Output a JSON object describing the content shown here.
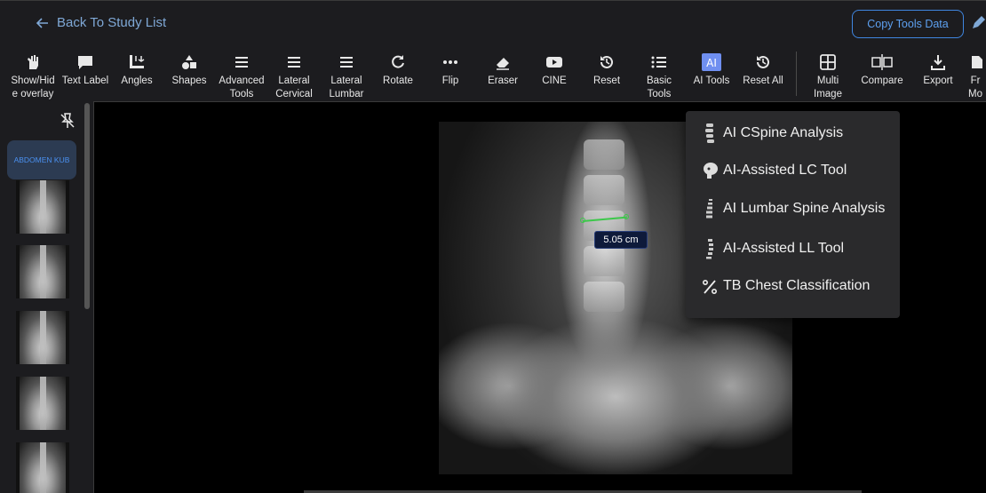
{
  "header": {
    "back_label": "Back To Study List",
    "copy_label": "Copy Tools Data"
  },
  "toolbar": {
    "items": [
      {
        "label": "Show/Hid\ne overlay",
        "icon": "hand-icon"
      },
      {
        "label": "Text Label",
        "icon": "chat-bubble-icon"
      },
      {
        "label": "Angles",
        "icon": "ruler-icon"
      },
      {
        "label": "Shapes",
        "icon": "shapes-icon"
      },
      {
        "label": "Advanced\nTools",
        "icon": "menu-icon"
      },
      {
        "label": "Lateral\nCervical",
        "icon": "menu-icon"
      },
      {
        "label": "Lateral\nLumbar",
        "icon": "menu-icon"
      },
      {
        "label": "Rotate",
        "icon": "rotate-icon"
      },
      {
        "label": "Flip",
        "icon": "dots-icon"
      },
      {
        "label": "Eraser",
        "icon": "eraser-icon"
      },
      {
        "label": "CINE",
        "icon": "play-icon"
      },
      {
        "label": "Reset",
        "icon": "history-icon"
      },
      {
        "label": "Basic\nTools",
        "icon": "list-icon"
      },
      {
        "label": "AI Tools",
        "icon": "ai-icon"
      },
      {
        "label": "Reset All",
        "icon": "history-icon"
      },
      {
        "label": "Multi\nImage",
        "icon": "grid-icon"
      },
      {
        "label": "Compare",
        "icon": "compare-icon"
      },
      {
        "label": "Export",
        "icon": "download-icon"
      },
      {
        "label": "Fr\nMo",
        "icon": "frame-icon"
      }
    ]
  },
  "sidebar": {
    "series_label": "ABDOMEN KUB"
  },
  "viewer": {
    "measurement": "5.05 cm"
  },
  "ai_menu": {
    "items": [
      {
        "label": "AI CSpine Analysis",
        "icon": "cervical-spine-icon"
      },
      {
        "label": "AI-Assisted LC Tool",
        "icon": "skull-icon"
      },
      {
        "label": "AI Lumbar Spine Analysis",
        "icon": "lumbar-spine-icon"
      },
      {
        "label": "AI-Assisted LL Tool",
        "icon": "spine-icon"
      },
      {
        "label": "TB Chest Classification",
        "icon": "percent-icon"
      }
    ]
  },
  "colors": {
    "accent": "#3f86e0",
    "measure": "#3cc84a",
    "background": "#1c1c1f"
  }
}
